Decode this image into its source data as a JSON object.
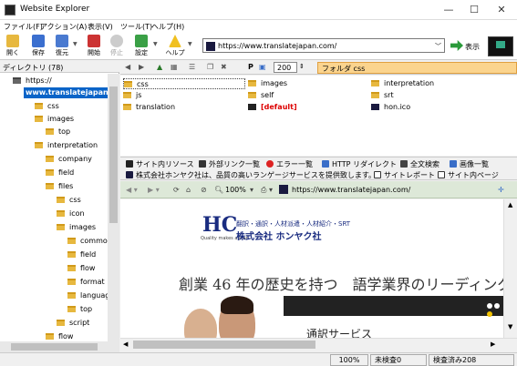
{
  "window": {
    "title": "Website Explorer",
    "controls": [
      "—",
      "☐",
      "✕"
    ]
  },
  "menu": [
    "ファイル(F)",
    "アクション(A)",
    "表示(V)",
    "ツール(T)",
    "ヘルプ(H)"
  ],
  "toolbar": {
    "buttons": [
      "開く",
      "保存",
      "復元",
      "開始",
      "停止",
      "設定",
      "ヘルプ"
    ],
    "url": "https://www.translatejapan.com/",
    "go_label": "表示"
  },
  "sidebar": {
    "header": "ディレクトリ (78)",
    "items": [
      "https://",
      "www.translatejapan",
      "css",
      "images",
      "top",
      "interpretation",
      "company",
      "field",
      "files",
      "css",
      "icon",
      "images",
      "common",
      "field",
      "flow",
      "format",
      "language",
      "top",
      "script",
      "flow"
    ]
  },
  "filetools": {
    "zoom_value": "200",
    "folder_label": "フォルダ css"
  },
  "files": [
    "css",
    "images",
    "interpretation",
    "js",
    "self",
    "srt",
    "translation",
    "[default]",
    "hon.ico"
  ],
  "tabs1": [
    "サイト内リソース",
    "外部リンク一覧",
    "エラー一覧",
    "HTTP リダイレクト",
    "全文検索",
    "画像一覧"
  ],
  "tabs2": [
    "株式会社ホンヤク社は、品質の高いランゲージサービスを提供致します。",
    "サイトレポート",
    "サイト内ページ"
  ],
  "navbar": {
    "zoom": "100%",
    "url": "https://www.translatejapan.com/"
  },
  "webpage": {
    "logo_mark": "HC",
    "logo_tagline": "Quality makes a plan",
    "company_line1": "翻訳・通訳・人材派遣・人材紹介・SRT",
    "company_line2": "株式会社 ホンヤク社",
    "headline": "創業 46 年の歴史を持つ　語学業界のリーディング",
    "service": "通訳サービス"
  },
  "status": {
    "zoom": "100%",
    "unchecked": "未検査0",
    "checked": "検査済み208"
  },
  "colors": {
    "selection": "#0a64c8",
    "folder": "#e7b83f",
    "folder_bar": "#fbd48e",
    "nav_bg": "#dde8d8",
    "default_red": "#d00000",
    "logo_blue": "#1a2c80"
  }
}
